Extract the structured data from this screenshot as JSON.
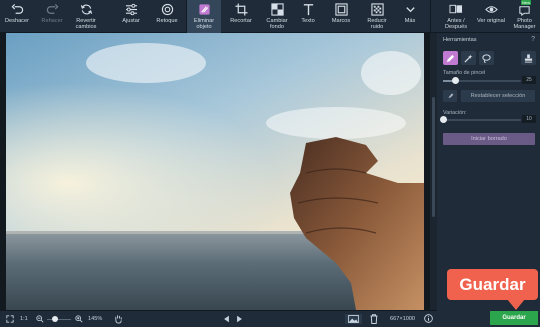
{
  "toolbar": {
    "undo": "Deshacer",
    "redo": "Rehacer",
    "revert": "Revertir cambios",
    "adjust": "Ajustar",
    "retouch": "Retoque",
    "remove_object": "Eliminar objeto",
    "crop": "Recortar",
    "change_bg": "Cambiar fondo",
    "text": "Texto",
    "frames": "Marcos",
    "noise": "Reducir ruido",
    "more": "Más",
    "before_after": "Antes / Después",
    "original": "Ver original",
    "photo_manager": "Photo Manager",
    "new_badge": "New"
  },
  "panel": {
    "title": "Herramientas",
    "help": "?",
    "brush_size_label": "Tamaño de pincel",
    "brush_size_value": "25",
    "brush_size_fraction": 0.16,
    "reset_label": "Restablecer selección",
    "variation_label": "Variación:",
    "variation_value": "10",
    "variation_fraction": 0.0,
    "start_label": "Iniciar borrado"
  },
  "bottom": {
    "one_to_one": "1:1",
    "zoom": "145%",
    "dimensions": "667×1000",
    "zoom_fraction": 0.35
  },
  "save": {
    "label": "Guardar",
    "callout": "Guardar"
  },
  "colors": {
    "accent_purple": "#c17ad2",
    "save_green": "#2ca64c",
    "callout_red": "#f1624e"
  }
}
